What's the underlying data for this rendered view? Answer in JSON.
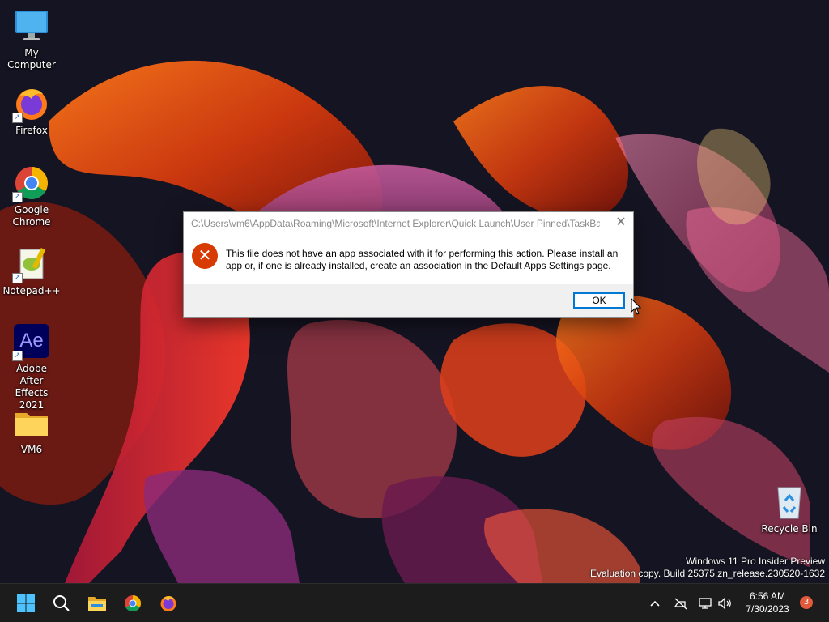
{
  "desktop": {
    "icons": [
      {
        "label": "My Computer",
        "icon": "monitor-icon"
      },
      {
        "label": "Firefox",
        "icon": "firefox-icon"
      },
      {
        "label": "Google Chrome",
        "icon": "chrome-icon"
      },
      {
        "label": "Notepad++",
        "icon": "notepadpp-icon"
      },
      {
        "label": "Adobe After Effects 2021",
        "icon": "after-effects-icon",
        "glyph_text": "Ae"
      },
      {
        "label": "VM6",
        "icon": "folder-icon"
      },
      {
        "label": "Recycle Bin",
        "icon": "recycle-bin-icon"
      }
    ]
  },
  "dialog": {
    "title": "C:\\Users\\vm6\\AppData\\Roaming\\Microsoft\\Internet Explorer\\Quick Launch\\User Pinned\\TaskBa...",
    "close_glyph": "✕",
    "message": "This file does not have an app associated with it for performing this action. Please install an app or, if one is already installed, create an association in the Default Apps Settings page.",
    "ok_label": "OK",
    "error_glyph": "✕"
  },
  "watermark": {
    "line1": "Windows 11 Pro Insider Preview",
    "line2": "Evaluation copy. Build 25375.zn_release.230520-1632"
  },
  "taskbar": {
    "pinned": [
      "start-icon",
      "search-icon",
      "file-explorer-icon",
      "chrome-icon",
      "firefox-icon"
    ],
    "tray": [
      "chevron-up-icon",
      "network-offline-icon",
      "display-icon",
      "volume-icon"
    ],
    "time": "6:56 AM",
    "date": "7/30/2023",
    "notification_count": "3"
  },
  "colors": {
    "error_red": "#d83b01",
    "accent_blue": "#0078d4",
    "taskbar_bg": "#1c1c1c"
  }
}
